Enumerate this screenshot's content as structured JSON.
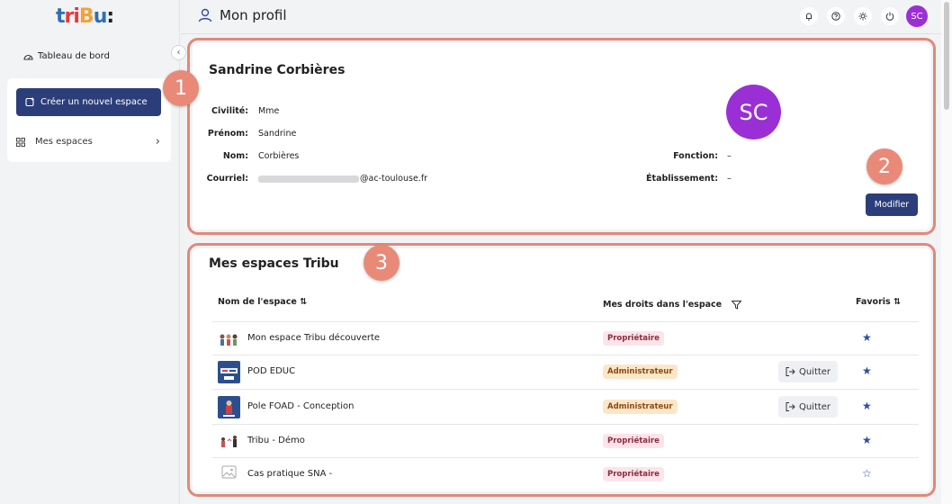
{
  "app": {
    "logo_parts": [
      "t",
      "ri",
      "B",
      "u",
      ":"
    ]
  },
  "sidebar": {
    "dashboard_label": "Tableau de bord",
    "create_label": "Créer un nouvel espace",
    "my_spaces_label": "Mes espaces",
    "collapse_glyph": "‹"
  },
  "header": {
    "title": "Mon profil",
    "avatar_initials": "SC",
    "icons": [
      "bell-icon",
      "help-icon",
      "sun-icon",
      "power-icon"
    ]
  },
  "profile": {
    "name": "Sandrine Corbières",
    "avatar_initials": "SC",
    "avatar_color": "#9b2fd6",
    "fields": {
      "civilite_label": "Civilité:",
      "civilite_value": "Mme",
      "prenom_label": "Prénom:",
      "prenom_value": "Sandrine",
      "nom_label": "Nom:",
      "nom_value": "Corbières",
      "courriel_label": "Courriel:",
      "courriel_value": "@ac-toulouse.fr",
      "fonction_label": "Fonction:",
      "fonction_value": "–",
      "etablissement_label": "Établissement:",
      "etablissement_value": "–"
    },
    "modify_label": "Modifier"
  },
  "spaces": {
    "title": "Mes espaces Tribu",
    "columns": {
      "name": "Nom de l'espace",
      "rights": "Mes droits dans l'espace",
      "favorites": "Favoris"
    },
    "rows": [
      {
        "name": "Mon espace Tribu découverte",
        "role": "Propriétaire",
        "quit": "",
        "favorite": "★"
      },
      {
        "name": "POD EDUC",
        "role": "Administrateur",
        "quit": "Quitter",
        "favorite": "★"
      },
      {
        "name": "Pole FOAD - Conception",
        "role": "Administrateur",
        "quit": "Quitter",
        "favorite": "★"
      },
      {
        "name": "Tribu - Démo",
        "role": "Propriétaire",
        "quit": "",
        "favorite": "★"
      },
      {
        "name": "Cas pratique SNA -",
        "role": "Propriétaire",
        "quit": "",
        "favorite": "☆"
      }
    ]
  },
  "callouts": [
    "1",
    "2",
    "3"
  ],
  "colors": {
    "accent": "#2c3e7a",
    "callout": "#e98a78",
    "avatar": "#9b2fd6"
  }
}
